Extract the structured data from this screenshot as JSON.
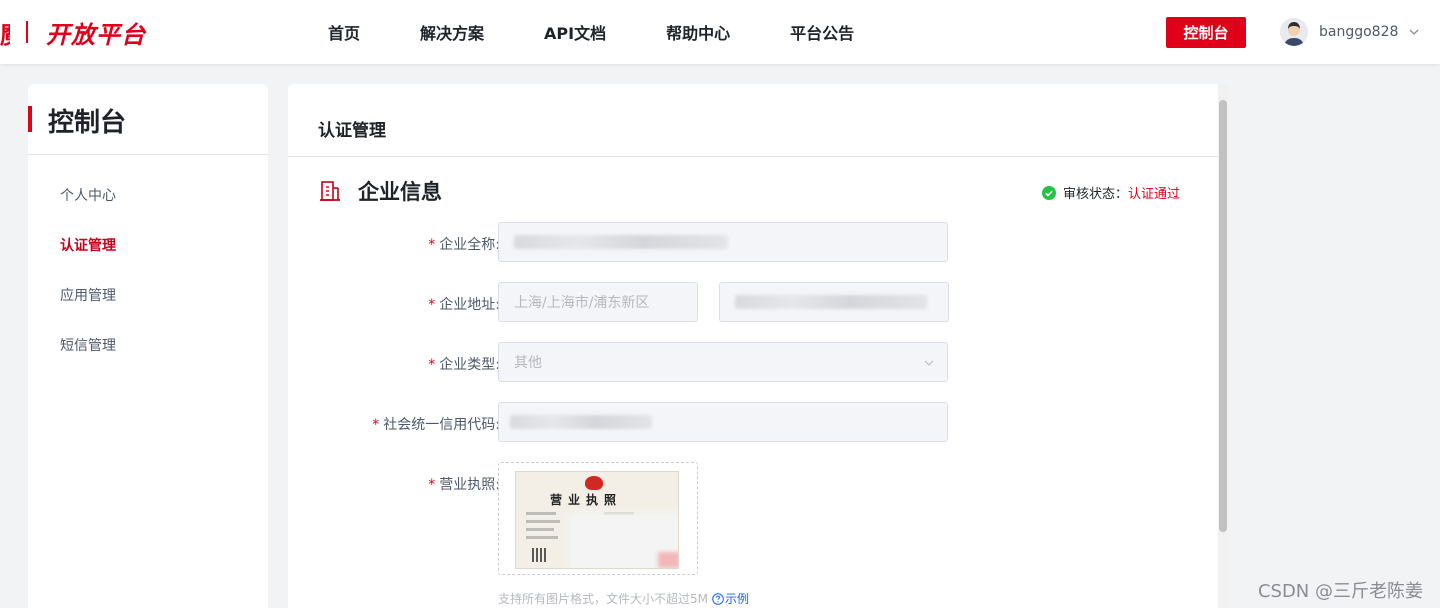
{
  "header": {
    "logo_fragment": "魔",
    "logo_text": "开放平台",
    "nav": [
      "首页",
      "解决方案",
      "API文档",
      "帮助中心",
      "平台公告"
    ],
    "console_button": "控制台",
    "username": "banggo828"
  },
  "sidebar": {
    "title": "控制台",
    "items": [
      {
        "label": "个人中心",
        "active": false
      },
      {
        "label": "认证管理",
        "active": true
      },
      {
        "label": "应用管理",
        "active": false
      },
      {
        "label": "短信管理",
        "active": false
      }
    ]
  },
  "main": {
    "title": "认证管理",
    "section_title": "企业信息",
    "status_label": "审核状态：",
    "status_value": "认证通过",
    "fields": {
      "full_name_label": "企业全称:",
      "address_label": "企业地址:",
      "address_region": "上海/上海市/浦东新区",
      "type_label": "企业类型:",
      "type_value": "其他",
      "credit_code_label": "社会统一信用代码:",
      "license_label": "营业执照:"
    },
    "license_image_title": "营业执照",
    "upload_hint": "支持所有图片格式，文件大小不超过5M",
    "example_link": "示例"
  },
  "watermark": "CSDN @三斤老陈姜",
  "colors": {
    "brand": "#e1001a",
    "link": "#1664ff",
    "success": "#23c343"
  }
}
